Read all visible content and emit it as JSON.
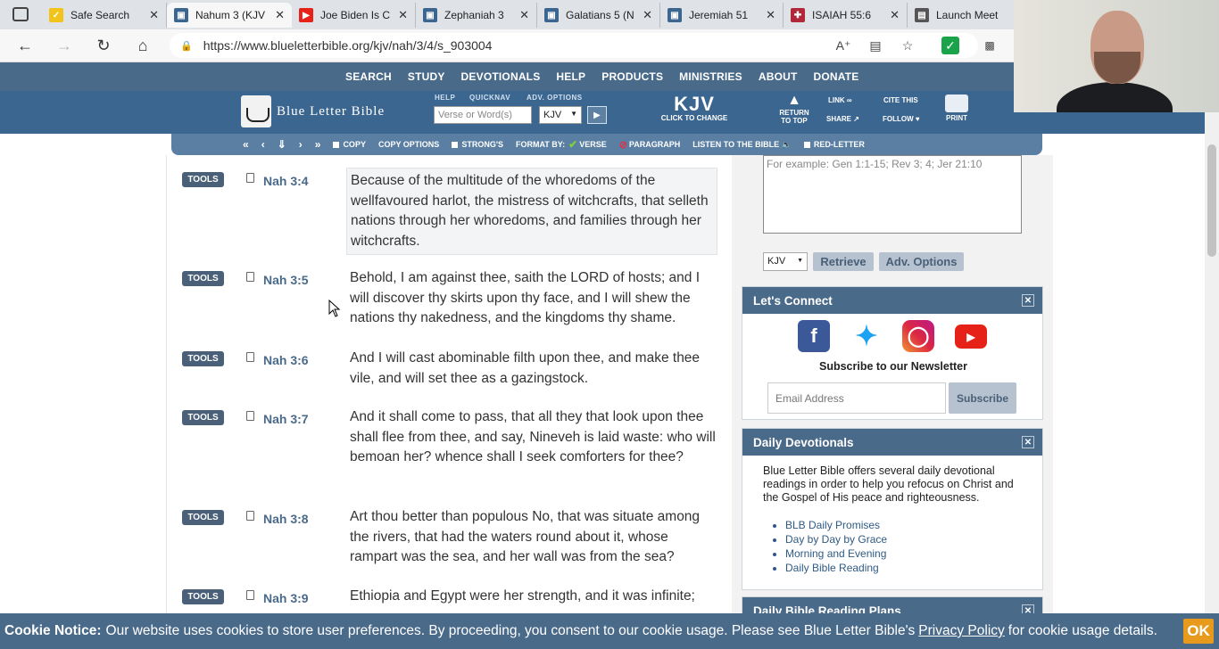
{
  "browser": {
    "tabs": [
      {
        "title": "Safe Search",
        "icon": "check-icon",
        "color": "#f2c31b"
      },
      {
        "title": "Nahum 3 (KJV",
        "icon": "blb-icon",
        "color": "#3b6690"
      },
      {
        "title": "Joe Biden Is C",
        "icon": "youtube-icon",
        "color": "#e62117"
      },
      {
        "title": "Zephaniah 3",
        "icon": "blb-icon",
        "color": "#3b6690"
      },
      {
        "title": "Galatians 5 (N",
        "icon": "blb-icon",
        "color": "#3b6690"
      },
      {
        "title": "Jeremiah 51",
        "icon": "blb-icon",
        "color": "#3b6690"
      },
      {
        "title": "ISAIAH 55:6",
        "icon": "bible-icon",
        "color": "#b0283a"
      },
      {
        "title": "Launch Meet",
        "icon": "document-icon",
        "color": "#555555"
      }
    ],
    "url": "https://www.blueletterbible.org/kjv/nah/3/4/s_903004"
  },
  "site": {
    "topnav": [
      "SEARCH",
      "STUDY",
      "DEVOTIONALS",
      "HELP",
      "PRODUCTS",
      "MINISTRIES",
      "ABOUT",
      "DONATE"
    ],
    "logo_text": "Blue Letter Bible",
    "help_label": "HELP",
    "quicknav_label": "QUICKNAV",
    "adv_options_label": "ADV. OPTIONS",
    "quicknav_placeholder": "Verse or Word(s)",
    "version_select": "KJV",
    "version_big": "KJV",
    "version_change": "CLICK TO CHANGE",
    "return_top": "RETURN TO TOP",
    "link": "LINK",
    "share": "SHARE",
    "cite": "CITE THIS",
    "follow": "FOLLOW",
    "print": "PRINT"
  },
  "verse_toolbar": {
    "copy": "COPY",
    "copy_options": "COPY OPTIONS",
    "strongs": "STRONG'S",
    "format_by": "FORMAT BY:",
    "verse": "VERSE",
    "paragraph": "PARAGRAPH",
    "listen": "LISTEN TO THE BIBLE",
    "red_letter": "RED-LETTER"
  },
  "verses": [
    {
      "tools": "TOOLS",
      "ref": "Nah 3:4",
      "text": "Because of the multitude of the whoredoms of the wellfavoured harlot, the mistress of witchcrafts, that selleth nations through her whoredoms, and families through her witchcrafts."
    },
    {
      "tools": "TOOLS",
      "ref": "Nah 3:5",
      "text": "Behold, I am against thee, saith the LORD of hosts; and I will discover thy skirts upon thy face, and I will shew the nations thy nakedness, and the kingdoms thy shame."
    },
    {
      "tools": "TOOLS",
      "ref": "Nah 3:6",
      "text": "And I will cast abominable filth upon thee, and make thee vile, and will set thee as a gazingstock."
    },
    {
      "tools": "TOOLS",
      "ref": "Nah 3:7",
      "text": "And it shall come to pass, that all they that look upon thee shall flee from thee, and say, Nineveh is laid waste: who will bemoan her? whence shall I seek comforters for thee?"
    },
    {
      "tools": "TOOLS",
      "ref": "Nah 3:8",
      "text": "Art thou better than populous No, that was situate among the rivers, that had the waters round about it, whose rampart was the sea, and her wall was from the sea?"
    },
    {
      "tools": "TOOLS",
      "ref": "Nah 3:9",
      "text": "Ethiopia and Egypt were her strength, and it was infinite;"
    }
  ],
  "sidebar": {
    "search_placeholder": "For example: Gen 1:1-15; Rev 3; 4; Jer 21:10",
    "version": "KJV",
    "retrieve": "Retrieve",
    "adv_options": "Adv. Options",
    "connect_title": "Let's Connect",
    "newsletter_label": "Subscribe to our Newsletter",
    "email_placeholder": "Email Address",
    "subscribe": "Subscribe",
    "devotionals_title": "Daily Devotionals",
    "devotionals_text": "Blue Letter Bible offers several daily devotional readings in order to help you refocus on Christ and the Gospel of His peace and righteousness.",
    "devotional_links": [
      "BLB Daily Promises",
      "Day by Day by Grace",
      "Morning and Evening",
      "Daily Bible Reading"
    ],
    "plans_title": "Daily Bible Reading Plans"
  },
  "cookie": {
    "label": "Cookie Notice:",
    "text": "Our website uses cookies to store user preferences. By proceeding, you consent to our cookie usage. Please see Blue Letter Bible's",
    "link": "Privacy Policy",
    "suffix": "for cookie usage details.",
    "ok": "OK"
  }
}
